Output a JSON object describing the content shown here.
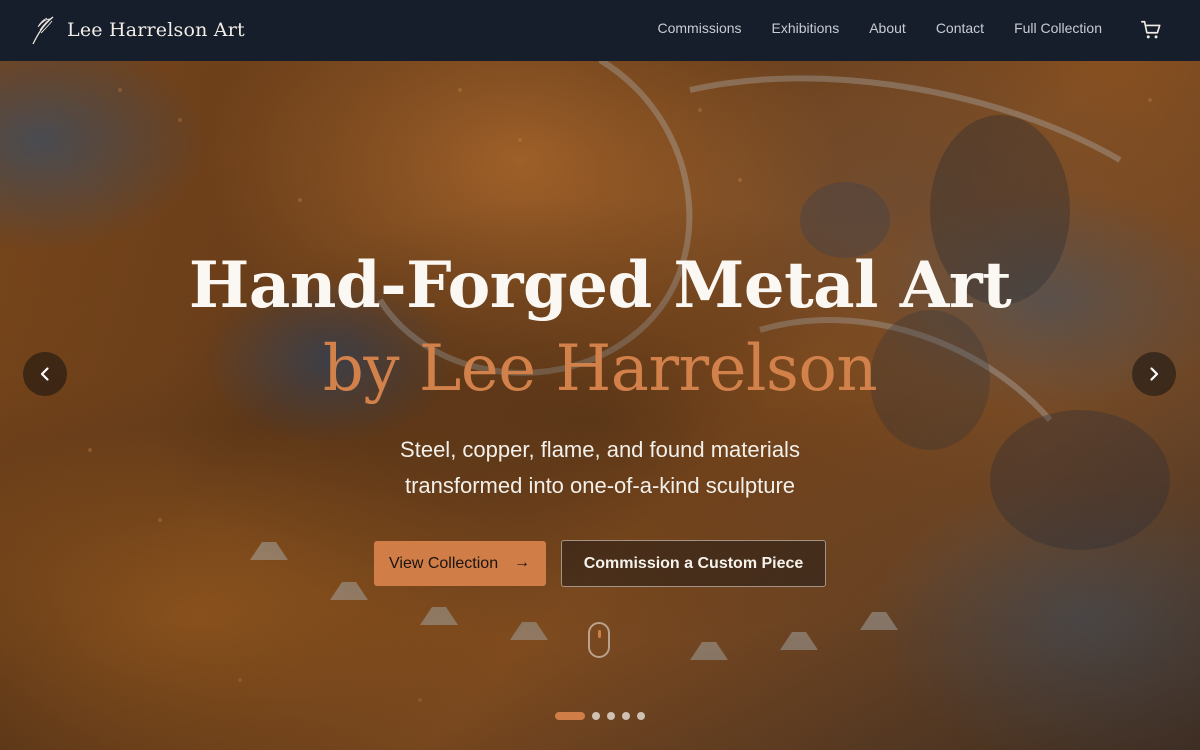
{
  "nav": {
    "brand_name": "Lee Harrelson Art",
    "links": [
      "Commissions",
      "Exhibitions",
      "About",
      "Contact",
      "Full Collection"
    ],
    "cart_icon": "cart-icon",
    "brand_icon": "quill-icon"
  },
  "hero": {
    "headline": "Hand-Forged Metal Art",
    "headline_accent": "by Lee Harrelson",
    "subtitle_line1": "Steel, copper, flame, and found materials",
    "subtitle_line2": "transformed into one-of-a-kind sculpture",
    "primary_cta": "View Collection",
    "primary_cta_icon": "arrow-right-icon",
    "secondary_cta": "Commission a Custom Piece",
    "prev_icon": "chevron-left-icon",
    "next_icon": "chevron-right-icon",
    "slides_total": 5,
    "slide_active": 1
  },
  "colors": {
    "accent": "#d17d47",
    "nav_bg": "#161d2b",
    "text_light": "#fbf8f3"
  }
}
